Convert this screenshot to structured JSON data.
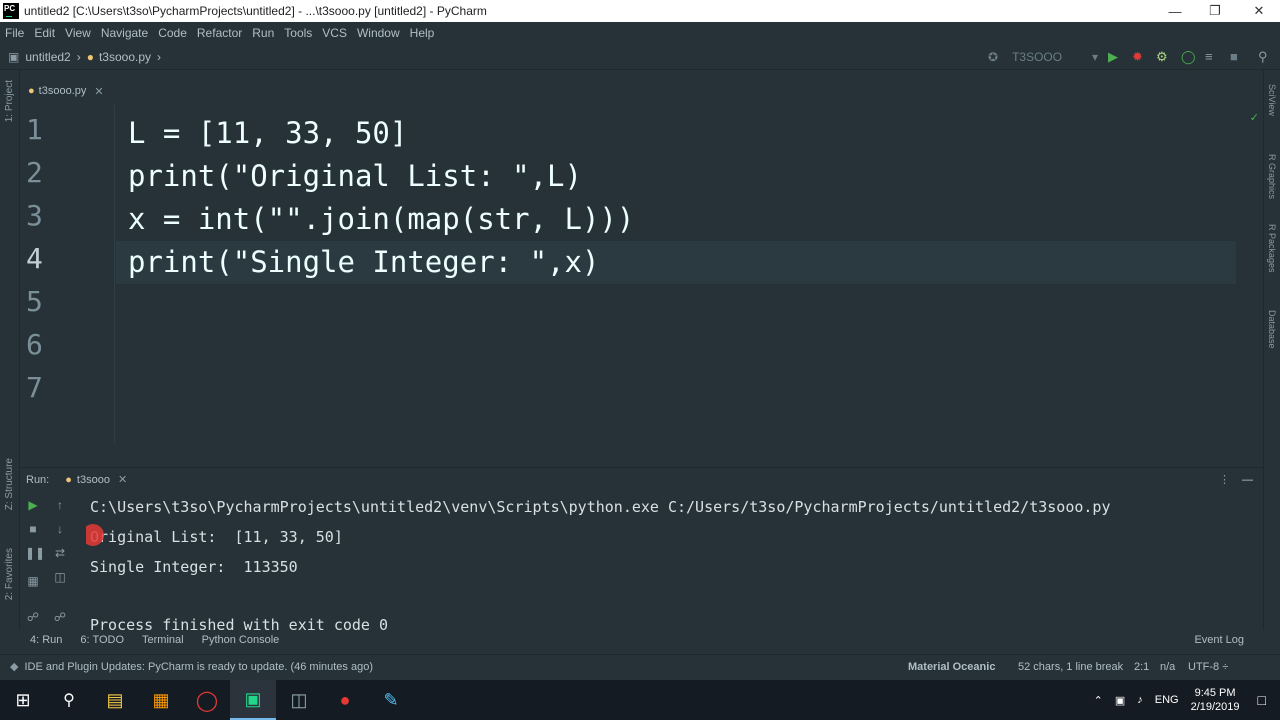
{
  "window": {
    "title": "untitled2 [C:\\Users\\t3so\\PycharmProjects\\untitled2] - ...\\t3sooo.py [untitled2] - PyCharm"
  },
  "menu": [
    "File",
    "Edit",
    "View",
    "Navigate",
    "Code",
    "Refactor",
    "Run",
    "Tools",
    "VCS",
    "Window",
    "Help"
  ],
  "nav": {
    "project": "untitled2",
    "file": "t3sooo.py",
    "run_config": "T3SOOO"
  },
  "tabs": [
    {
      "label": "t3sooo.py"
    }
  ],
  "sidebar_left": {
    "project": "1: Project",
    "structure": "Z: Structure",
    "favorites": "2: Favorites"
  },
  "sidebar_right": {
    "sciview": "SciView",
    "rgraphics": "R Graphics",
    "rpackages": "R Packages",
    "database": "Database"
  },
  "editor": {
    "line_numbers": [
      "1",
      "2",
      "3",
      "4",
      "5",
      "6",
      "7"
    ],
    "lines": [
      "L = [11, 33, 50]",
      "print(\"Original List: \",L)",
      "x = int(\"\".join(map(str, L)))",
      "print(\"Single Integer: \",x)"
    ]
  },
  "run": {
    "label": "Run:",
    "tab": "t3sooo",
    "output": [
      "C:\\Users\\t3so\\PycharmProjects\\untitled2\\venv\\Scripts\\python.exe C:/Users/t3so/PycharmProjects/untitled2/t3sooo.py",
      "Original List:  [11, 33, 50]",
      "Single Integer:  113350",
      "",
      "Process finished with exit code 0"
    ]
  },
  "bottom_tabs": {
    "run": "4: Run",
    "todo": "6: TODO",
    "terminal": "Terminal",
    "console": "Python Console",
    "event_log": "Event Log"
  },
  "status": {
    "message": "IDE and Plugin Updates: PyCharm is ready to update. (46 minutes ago)",
    "theme": "Material Oceanic",
    "chars": "52 chars, 1 line break",
    "pos": "2:1",
    "na": "n/a",
    "encoding": "UTF-8 ÷"
  },
  "tray": {
    "lang": "ENG",
    "time": "9:45 PM",
    "date": "2/19/2019"
  },
  "colors": {
    "bg": "#263238",
    "accent": "#21d789"
  }
}
